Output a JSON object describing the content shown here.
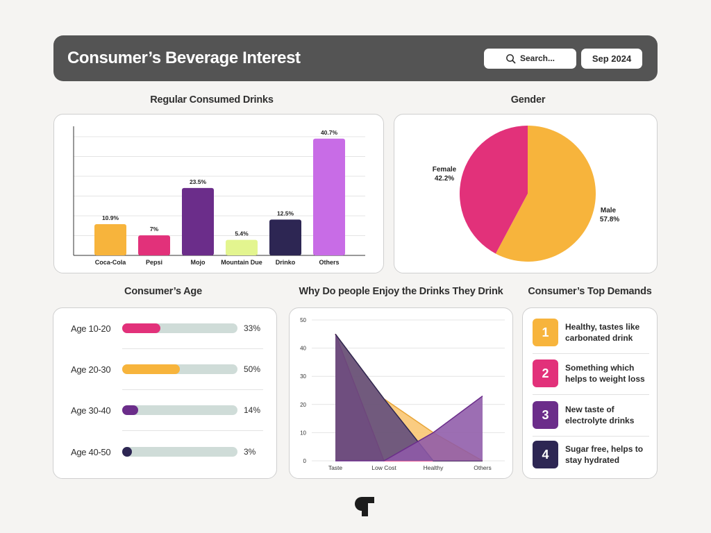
{
  "header": {
    "title": "Consumer’s Beverage Interest",
    "search_placeholder": "Search...",
    "date": "Sep 2024"
  },
  "sections": {
    "drinks_title": "Regular Consumed Drinks",
    "gender_title": "Gender",
    "age_title": "Consumer’s Age",
    "enjoy_title": "Why Do people Enjoy the Drinks They Drink",
    "demands_title": "Consumer’s Top Demands"
  },
  "chart_data": [
    {
      "type": "bar",
      "title": "Regular Consumed Drinks",
      "categories": [
        "Coca-Cola",
        "Pepsi",
        "Mojo",
        "Mountain Due",
        "Drinko",
        "Others"
      ],
      "values": [
        10.9,
        7,
        23.5,
        5.4,
        12.5,
        40.7
      ],
      "value_labels": [
        "10.9%",
        "7%",
        "23.5%",
        "5.4%",
        "12.5%",
        "40.7%"
      ],
      "colors": [
        "#f7b43c",
        "#e2317a",
        "#6b2d8a",
        "#e3f58f",
        "#2d2653",
        "#c86ce6"
      ],
      "ylim": [
        0,
        45
      ],
      "grid": true
    },
    {
      "type": "pie",
      "title": "Gender",
      "slices": [
        {
          "label": "Male",
          "value": 57.8,
          "value_label": "57.8%",
          "color": "#f7b43c"
        },
        {
          "label": "Female",
          "value": 42.2,
          "value_label": "42.2%",
          "color": "#e2317a"
        }
      ]
    },
    {
      "type": "area",
      "title": "Why Do people Enjoy the Drinks They Drink",
      "categories": [
        "Taste",
        "Low Cost",
        "Healthy",
        "Others"
      ],
      "ylim": [
        0,
        50
      ],
      "yticks": [
        0,
        10,
        20,
        30,
        40,
        50
      ],
      "grid": true,
      "series": [
        {
          "values": [
            45,
            22,
            10,
            0
          ],
          "color": "#f9c56f",
          "stroke": "#e8a63a"
        },
        {
          "values": [
            45,
            0,
            0,
            0
          ],
          "color": "#ec5d9a",
          "stroke": "#e2317a"
        },
        {
          "values": [
            45,
            22,
            0,
            0
          ],
          "color": "#5d4a7c",
          "stroke": "#2d2653"
        },
        {
          "values": [
            0,
            0,
            10,
            23
          ],
          "color": "#8e5aa8",
          "stroke": "#6b2d8a"
        }
      ]
    }
  ],
  "ages": [
    {
      "label": "Age 10-20",
      "value": 33,
      "pct": "33%",
      "color": "#e2317a"
    },
    {
      "label": "Age 20-30",
      "value": 50,
      "pct": "50%",
      "color": "#f7b43c"
    },
    {
      "label": "Age 30-40",
      "value": 14,
      "pct": "14%",
      "color": "#6b2d8a"
    },
    {
      "label": "Age 40-50",
      "value": 3,
      "pct": "3%",
      "color": "#2d2653"
    }
  ],
  "demands": [
    {
      "num": "1",
      "line1": "Healthy, tastes like",
      "line2": "carbonated drink",
      "color": "#f7b43c"
    },
    {
      "num": "2",
      "line1": "Something which",
      "line2": "helps to weight loss",
      "color": "#e2317a"
    },
    {
      "num": "3",
      "line1": "New taste of",
      "line2": "electrolyte drinks",
      "color": "#6b2d8a"
    },
    {
      "num": "4",
      "line1": "Sugar free, helps to",
      "line2": "stay hydrated",
      "color": "#2d2653"
    }
  ],
  "icons": {
    "search": "search-icon",
    "logo": "brand-logo"
  }
}
